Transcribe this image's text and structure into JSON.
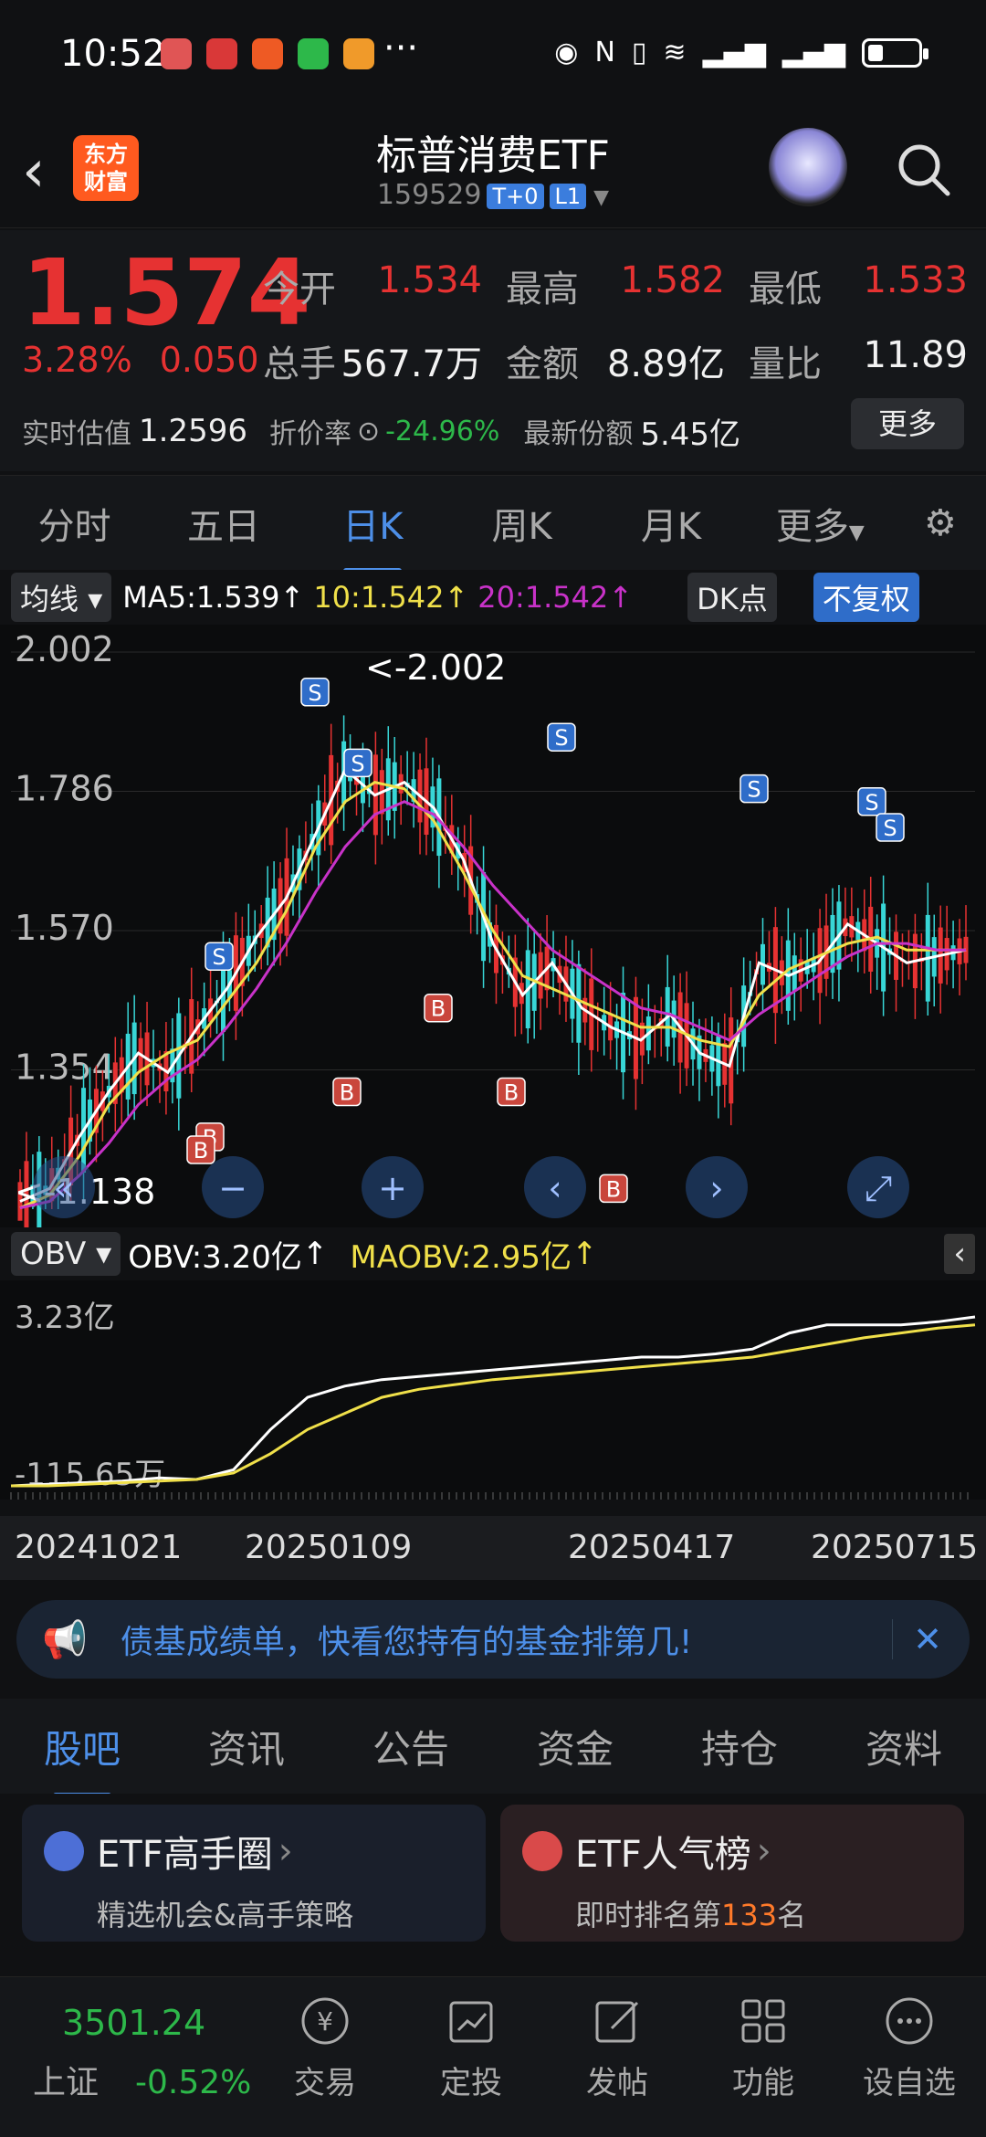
{
  "status": {
    "time": "10:52",
    "dots": "···"
  },
  "header": {
    "title": "标普消费ETF",
    "code": "159529",
    "tag1": "T+0",
    "tag2": "L1",
    "logo": "东方\n财富"
  },
  "quote": {
    "price": "1.574",
    "pct": "3.28%",
    "chg": "0.050",
    "open_k": "今开",
    "open_v": "1.534",
    "high_k": "最高",
    "high_v": "1.582",
    "low_k": "最低",
    "low_v": "1.533",
    "vol_k": "总手",
    "vol_v": "567.7万",
    "amt_k": "金额",
    "amt_v": "8.89亿",
    "ratio_k": "量比",
    "ratio_v": "11.89",
    "est_k": "实时估值",
    "est_v": "1.2596",
    "disc_k": "折价率",
    "disc_v": "-24.96%",
    "share_k": "最新份额",
    "share_v": "5.45亿",
    "more": "更多"
  },
  "ktabs": [
    "分时",
    "五日",
    "日K",
    "周K",
    "月K",
    "更多"
  ],
  "chartbar": {
    "ma_btn": "均线",
    "ma5": "MA5:1.539",
    "ma10": "10:1.542",
    "ma20": "20:1.542",
    "dk": "DK点",
    "fq": "不复权"
  },
  "chart_data": {
    "type": "line",
    "title": "",
    "yticks": [
      "2.002",
      "1.786",
      "1.570",
      "1.354"
    ],
    "max_label": "<-2.002",
    "min_label": "<-1.138",
    "x_start": "20241021",
    "x_end": "20250715",
    "ylim": [
      1.138,
      2.002
    ],
    "series": [
      {
        "name": "MA5",
        "color": "#ffffff",
        "values": [
          1.15,
          1.17,
          1.25,
          1.32,
          1.38,
          1.35,
          1.42,
          1.48,
          1.56,
          1.62,
          1.72,
          1.82,
          1.78,
          1.8,
          1.76,
          1.68,
          1.55,
          1.47,
          1.52,
          1.45,
          1.42,
          1.4,
          1.44,
          1.38,
          1.36,
          1.52,
          1.5,
          1.52,
          1.58,
          1.55,
          1.52,
          1.53,
          1.54
        ]
      },
      {
        "name": "10",
        "color": "#f0e04a",
        "values": [
          1.14,
          1.16,
          1.22,
          1.3,
          1.35,
          1.38,
          1.4,
          1.46,
          1.52,
          1.6,
          1.7,
          1.77,
          1.8,
          1.79,
          1.74,
          1.66,
          1.57,
          1.5,
          1.48,
          1.46,
          1.44,
          1.42,
          1.42,
          1.4,
          1.39,
          1.47,
          1.51,
          1.53,
          1.55,
          1.56,
          1.54,
          1.54,
          1.54
        ]
      },
      {
        "name": "20",
        "color": "#c832c8",
        "values": [
          1.14,
          1.15,
          1.19,
          1.24,
          1.3,
          1.34,
          1.37,
          1.42,
          1.48,
          1.55,
          1.63,
          1.7,
          1.75,
          1.77,
          1.75,
          1.7,
          1.64,
          1.59,
          1.54,
          1.51,
          1.48,
          1.45,
          1.44,
          1.42,
          1.4,
          1.44,
          1.47,
          1.5,
          1.53,
          1.55,
          1.55,
          1.54,
          1.54
        ]
      }
    ]
  },
  "obv": {
    "btn": "OBV",
    "obv": "OBV:3.20亿",
    "maobv": "MAOBV:2.95亿",
    "ytop": "3.23亿",
    "ybot": "-115.65万"
  },
  "obv_data": {
    "obv": [
      0,
      0.01,
      0.02,
      0.03,
      0.05,
      0.04,
      0.1,
      0.35,
      0.55,
      0.62,
      0.66,
      0.68,
      0.7,
      0.72,
      0.74,
      0.76,
      0.78,
      0.8,
      0.8,
      0.82,
      0.85,
      0.95,
      1.0,
      1.0,
      1.0,
      1.02,
      1.05
    ],
    "maobv": [
      0,
      0,
      0.01,
      0.02,
      0.03,
      0.04,
      0.08,
      0.2,
      0.35,
      0.45,
      0.55,
      0.6,
      0.63,
      0.66,
      0.68,
      0.7,
      0.72,
      0.74,
      0.76,
      0.78,
      0.8,
      0.84,
      0.88,
      0.92,
      0.95,
      0.98,
      1.0
    ]
  },
  "dates": [
    "20241021",
    "20250109",
    "20250417",
    "20250715"
  ],
  "banner": {
    "text": "债基成绩单，快看您持有的基金排第几!"
  },
  "ntabs": [
    "股吧",
    "资讯",
    "公告",
    "资金",
    "持仓",
    "资料"
  ],
  "cards": [
    {
      "title": "ETF高手圈",
      "sub": "精选机会&高手策略"
    },
    {
      "title": "ETF人气榜",
      "sub_a": "即时排名第",
      "rank": "133",
      "sub_b": "名"
    }
  ],
  "bottom": {
    "idx_v": "3501.24",
    "idx_n": "上证",
    "idx_p": "-0.52%",
    "nav": [
      "交易",
      "定投",
      "发帖",
      "功能",
      "设自选"
    ]
  },
  "colors": {
    "up": "#e63232",
    "down": "#2db84a",
    "accent": "#4d8fe8"
  }
}
